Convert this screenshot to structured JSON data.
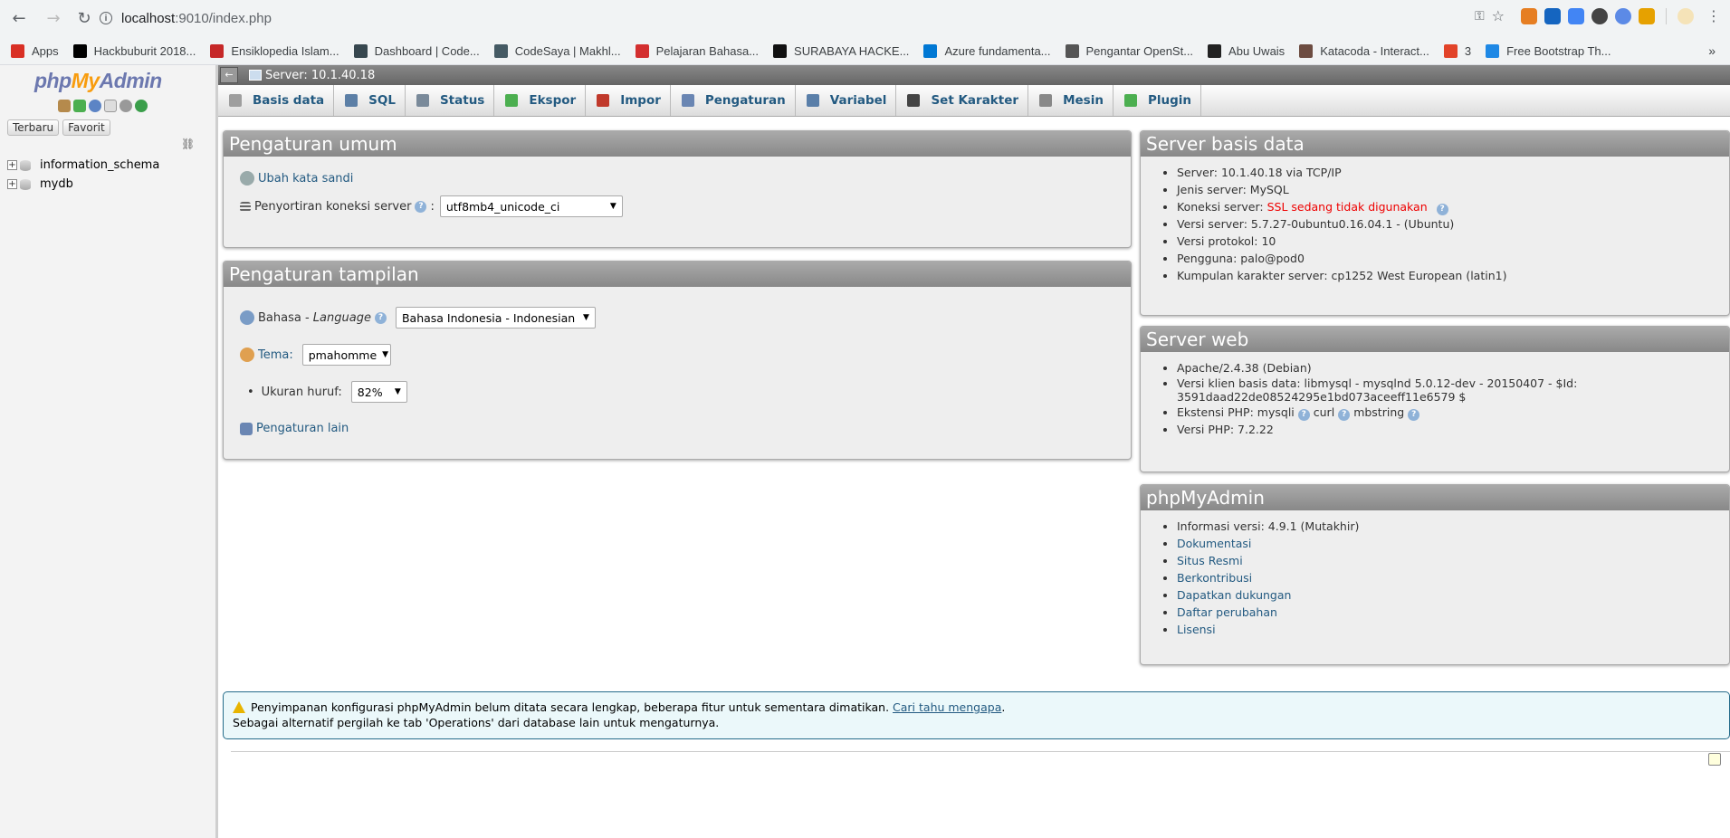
{
  "browser": {
    "url_host": "localhost",
    "url_rest": ":9010/index.php",
    "bookmarks": [
      {
        "label": "Apps",
        "color": "#d93025"
      },
      {
        "label": "Hackbuburit 2018...",
        "color": "#000000"
      },
      {
        "label": "Ensiklopedia Islam...",
        "color": "#c62828"
      },
      {
        "label": "Dashboard | Code...",
        "color": "#37474f"
      },
      {
        "label": "CodeSaya | Makhl...",
        "color": "#455a64"
      },
      {
        "label": "Pelajaran Bahasa...",
        "color": "#d32f2f"
      },
      {
        "label": "SURABAYA HACKE...",
        "color": "#111111"
      },
      {
        "label": "Azure fundamenta...",
        "color": "#0078d4"
      },
      {
        "label": "Pengantar OpenSt...",
        "color": "#555555"
      },
      {
        "label": "Abu Uwais",
        "color": "#222222"
      },
      {
        "label": "Katacoda - Interact...",
        "color": "#6d4c41"
      },
      {
        "label": "3",
        "color": "#e24329"
      },
      {
        "label": "Free Bootstrap Th...",
        "color": "#1e88e5"
      }
    ],
    "overflow": "»"
  },
  "sidebar": {
    "logo_php": "php",
    "logo_my": "My",
    "logo_admin": "Admin",
    "tab_recent": "Terbaru",
    "tab_favorite": "Favorit",
    "databases": [
      "information_schema",
      "mydb"
    ]
  },
  "topbar": {
    "back": "←",
    "server": "Server: 10.1.40.18"
  },
  "menu": [
    {
      "label": "Basis data",
      "icon": "database-icon",
      "color": "#9e9e9e"
    },
    {
      "label": "SQL",
      "icon": "sql-icon",
      "color": "#5c7fa6"
    },
    {
      "label": "Status",
      "icon": "status-icon",
      "color": "#7a8a9a"
    },
    {
      "label": "Ekspor",
      "icon": "export-icon",
      "color": "#4caf50"
    },
    {
      "label": "Impor",
      "icon": "import-icon",
      "color": "#c0392b"
    },
    {
      "label": "Pengaturan",
      "icon": "wrench-icon",
      "color": "#6a86b3"
    },
    {
      "label": "Variabel",
      "icon": "variables-icon",
      "color": "#5a7fa9"
    },
    {
      "label": "Set Karakter",
      "icon": "charset-icon",
      "color": "#444444"
    },
    {
      "label": "Mesin",
      "icon": "engine-icon",
      "color": "#888888"
    },
    {
      "label": "Plugin",
      "icon": "plugin-icon",
      "color": "#4caf50"
    }
  ],
  "general": {
    "title": "Pengaturan umum",
    "change_password": "Ubah kata sandi",
    "collation_label": "Penyortiran koneksi server",
    "collation_value": "utf8mb4_unicode_ci"
  },
  "appearance": {
    "title": "Pengaturan tampilan",
    "language_label": "Bahasa - ",
    "language_label_em": "Language",
    "language_value": "Bahasa Indonesia - Indonesian",
    "theme_label": "Tema:",
    "theme_value": "pmahomme",
    "fontsize_label": "Ukuran huruf:",
    "fontsize_value": "82%",
    "more_settings": "Pengaturan lain"
  },
  "db_server": {
    "title": "Server basis data",
    "items": [
      "Server: 10.1.40.18 via TCP/IP",
      "Jenis server: MySQL",
      "Versi server: 5.7.27-0ubuntu0.16.04.1 - (Ubuntu)",
      "Versi protokol: 10",
      "Pengguna: palo@pod0",
      "Kumpulan karakter server: cp1252 West European (latin1)"
    ],
    "connection_label": "Koneksi server: ",
    "connection_value": "SSL sedang tidak digunakan"
  },
  "web_server": {
    "title": "Server web",
    "apache": "Apache/2.4.38 (Debian)",
    "client_version": "Versi klien basis data: libmysql - mysqlnd 5.0.12-dev - 20150407 - $Id: 3591daad22de08524295e1bd073aceeff11e6579 $",
    "ext_label": "Ekstensi PHP: ",
    "ext_mysqli": "mysqli",
    "ext_curl": "curl",
    "ext_mbstring": "mbstring",
    "php_version": "Versi PHP: 7.2.22"
  },
  "pma": {
    "title": "phpMyAdmin",
    "version": "Informasi versi: 4.9.1 (Mutakhir)",
    "links": [
      "Dokumentasi",
      "Situs Resmi",
      "Berkontribusi",
      "Dapatkan dukungan",
      "Daftar perubahan",
      "Lisensi"
    ]
  },
  "notice": {
    "line1": "Penyimpanan konfigurasi phpMyAdmin belum ditata secara lengkap, beberapa fitur untuk sementara dimatikan. ",
    "link": "Cari tahu mengapa",
    "period": ".",
    "line2": "Sebagai alternatif pergilah ke tab 'Operations' dari database lain untuk mengaturnya."
  }
}
